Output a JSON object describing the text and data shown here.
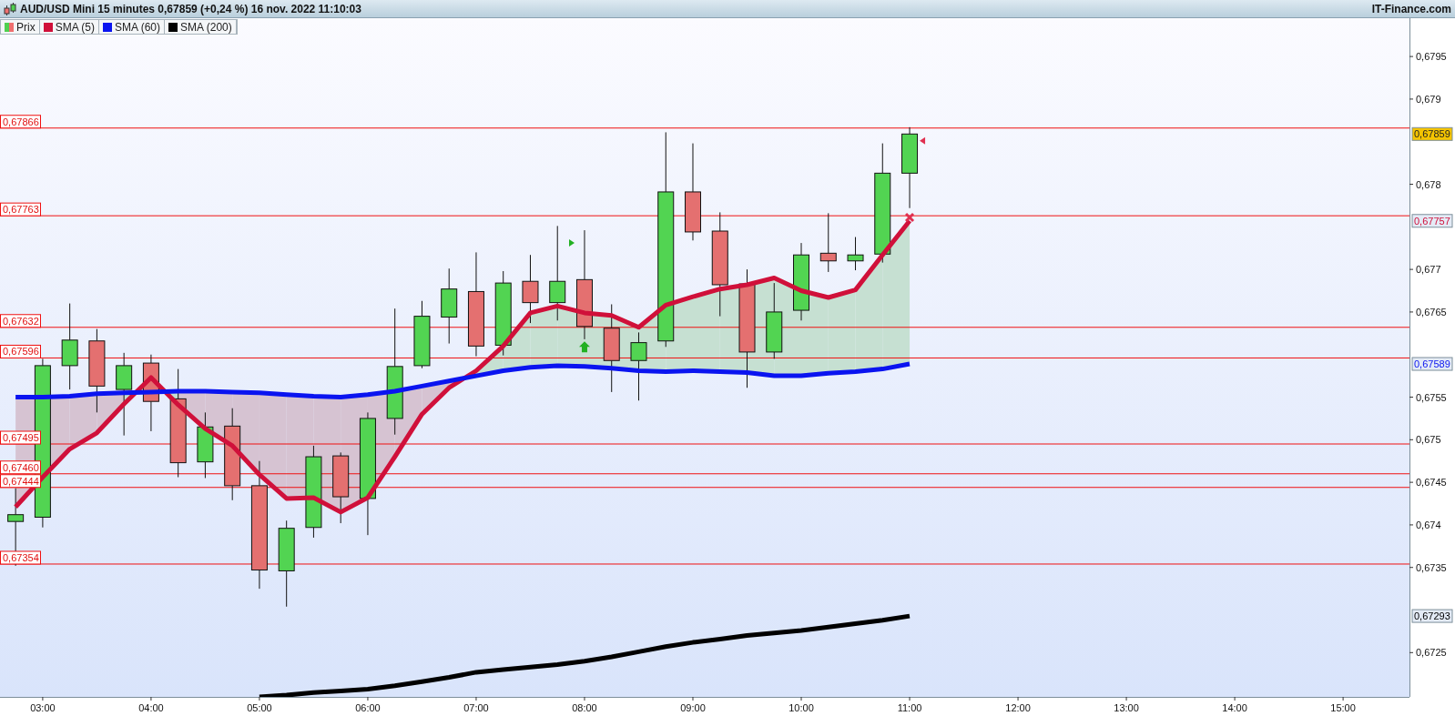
{
  "title_bar": {
    "title": "AUD/USD Mini 15 minutes 0,67859 (+0,24 %) 16 nov. 2022 11:10:03",
    "brand": "IT-Finance.com"
  },
  "chart_data": {
    "type": "line",
    "x": [
      2.75,
      3,
      3.25,
      3.5,
      3.75,
      4,
      4.25,
      4.5,
      4.75,
      5,
      5.25,
      5.5,
      5.75,
      6,
      6.25,
      6.5,
      6.75,
      7,
      7.25,
      7.5,
      7.75,
      8,
      8.25,
      8.5,
      8.75,
      9,
      9.25,
      9.5,
      9.75,
      10,
      10.25,
      10.5,
      10.75,
      11
    ],
    "xlim": [
      2.606,
      15.6125
    ],
    "ylim": [
      0.67198,
      0.67995
    ],
    "xticks": [
      {
        "value": 3,
        "label": "03:00"
      },
      {
        "value": 4,
        "label": "04:00"
      },
      {
        "value": 5,
        "label": "05:00"
      },
      {
        "value": 6,
        "label": "06:00"
      },
      {
        "value": 7,
        "label": "07:00"
      },
      {
        "value": 8,
        "label": "08:00"
      },
      {
        "value": 9,
        "label": "09:00"
      },
      {
        "value": 10,
        "label": "10:00"
      },
      {
        "value": 11,
        "label": "11:00"
      },
      {
        "value": 12,
        "label": "12:00"
      },
      {
        "value": 13,
        "label": "13:00"
      },
      {
        "value": 14,
        "label": "14:00"
      },
      {
        "value": 15,
        "label": "15:00"
      }
    ],
    "yticks": [
      {
        "value": 0.6795,
        "label": "0,6795"
      },
      {
        "value": 0.679,
        "label": "0,679"
      },
      {
        "value": 0.678,
        "label": "0,678"
      },
      {
        "value": 0.677,
        "label": "0,677"
      },
      {
        "value": 0.6765,
        "label": "0,6765"
      },
      {
        "value": 0.6755,
        "label": "0,6755"
      },
      {
        "value": 0.675,
        "label": "0,675"
      },
      {
        "value": 0.6745,
        "label": "0,6745"
      },
      {
        "value": 0.674,
        "label": "0,674"
      },
      {
        "value": 0.6735,
        "label": "0,6735"
      },
      {
        "value": 0.6725,
        "label": "0,6725"
      }
    ],
    "series": [
      {
        "name": "Prix",
        "type": "candlestick",
        "ohlc": [
          [
            0.67404,
            0.67443,
            0.67352,
            0.67412
          ],
          [
            0.67409,
            0.67595,
            0.67397,
            0.67587
          ],
          [
            0.67587,
            0.6766,
            0.67559,
            0.67617
          ],
          [
            0.67616,
            0.6763,
            0.67532,
            0.67563
          ],
          [
            0.67559,
            0.67602,
            0.67505,
            0.67587
          ],
          [
            0.6759,
            0.676,
            0.6751,
            0.67545
          ],
          [
            0.67548,
            0.67583,
            0.67456,
            0.67473
          ],
          [
            0.67474,
            0.67532,
            0.67455,
            0.67515
          ],
          [
            0.67516,
            0.67537,
            0.67429,
            0.67446
          ],
          [
            0.67446,
            0.67475,
            0.67325,
            0.67347
          ],
          [
            0.67346,
            0.67405,
            0.67304,
            0.67396
          ],
          [
            0.67397,
            0.67493,
            0.67385,
            0.6748
          ],
          [
            0.67481,
            0.67485,
            0.67402,
            0.67433
          ],
          [
            0.67431,
            0.67532,
            0.67388,
            0.67525
          ],
          [
            0.67525,
            0.67654,
            0.67506,
            0.67586
          ],
          [
            0.67587,
            0.67663,
            0.67584,
            0.67645
          ],
          [
            0.67644,
            0.67701,
            0.67613,
            0.67677
          ],
          [
            0.67674,
            0.6772,
            0.67598,
            0.6761
          ],
          [
            0.67611,
            0.67698,
            0.67599,
            0.67684
          ],
          [
            0.67686,
            0.67717,
            0.67637,
            0.67661
          ],
          [
            0.67661,
            0.67751,
            0.6764,
            0.67686
          ],
          [
            0.67688,
            0.67746,
            0.67618,
            0.67633
          ],
          [
            0.67631,
            0.67659,
            0.67556,
            0.67593
          ],
          [
            0.67593,
            0.67626,
            0.67546,
            0.67614
          ],
          [
            0.67616,
            0.67861,
            0.67609,
            0.67791
          ],
          [
            0.67791,
            0.67848,
            0.67734,
            0.67744
          ],
          [
            0.67745,
            0.67767,
            0.67645,
            0.67682
          ],
          [
            0.67683,
            0.677,
            0.67561,
            0.67603
          ],
          [
            0.67603,
            0.67684,
            0.67595,
            0.6765
          ],
          [
            0.67652,
            0.67731,
            0.6764,
            0.67717
          ],
          [
            0.67719,
            0.67766,
            0.67697,
            0.6771
          ],
          [
            0.6771,
            0.67738,
            0.67699,
            0.67717
          ],
          [
            0.67718,
            0.67848,
            0.67708,
            0.67813
          ],
          [
            0.67813,
            0.67867,
            0.67772,
            0.67859
          ]
        ]
      },
      {
        "name": "SMA (5)",
        "color": "#d0103a",
        "values": [
          0.67421,
          0.67456,
          0.67489,
          0.67508,
          0.67542,
          0.67573,
          0.67541,
          0.67513,
          0.67493,
          0.67459,
          0.67431,
          0.67432,
          0.67415,
          0.67432,
          0.6748,
          0.6753,
          0.67561,
          0.67581,
          0.6761,
          0.67649,
          0.67657,
          0.67649,
          0.67646,
          0.67632,
          0.67658,
          0.67668,
          0.67677,
          0.67682,
          0.6769,
          0.67675,
          0.67667,
          0.67676,
          0.67717,
          0.67757
        ]
      },
      {
        "name": "SMA (60)",
        "color": "#0a14f0",
        "values": [
          0.6755,
          0.6755,
          0.67551,
          0.67554,
          0.67555,
          0.67556,
          0.67557,
          0.67557,
          0.67556,
          0.67555,
          0.67553,
          0.67551,
          0.6755,
          0.67553,
          0.67557,
          0.67563,
          0.67569,
          0.67575,
          0.67581,
          0.67585,
          0.67587,
          0.67586,
          0.67584,
          0.67581,
          0.6758,
          0.67581,
          0.6758,
          0.67579,
          0.67575,
          0.67575,
          0.67578,
          0.6758,
          0.67583,
          0.67589
        ]
      },
      {
        "name": "SMA (200)",
        "color": "#000000",
        "values": [
          null,
          null,
          null,
          null,
          null,
          null,
          null,
          null,
          null,
          0.67198,
          0.672,
          0.67203,
          0.67205,
          0.67207,
          0.67211,
          0.67216,
          0.67221,
          0.67227,
          0.6723,
          0.67233,
          0.67236,
          0.6724,
          0.67245,
          0.67251,
          0.67257,
          0.67262,
          0.67266,
          0.6727,
          0.67273,
          0.67276,
          0.6728,
          0.67284,
          0.67288,
          0.67293
        ]
      }
    ],
    "ref_lines": [
      {
        "axis": "y",
        "value": 0.67866,
        "label": "0,67866"
      },
      {
        "axis": "y",
        "value": 0.67763,
        "label": "0,67763"
      },
      {
        "axis": "y",
        "value": 0.67632,
        "label": "0,67632"
      },
      {
        "axis": "y",
        "value": 0.67596,
        "label": "0,67596"
      },
      {
        "axis": "y",
        "value": 0.67495,
        "label": "0,67495"
      },
      {
        "axis": "y",
        "value": 0.6746,
        "label": "0,67460"
      },
      {
        "axis": "y",
        "value": 0.67444,
        "label": "0,67444"
      },
      {
        "axis": "y",
        "value": 0.67354,
        "label": "0,67354"
      }
    ]
  },
  "price_badges": [
    {
      "label": "0,67859"
    },
    {
      "label": "0,67757"
    },
    {
      "label": "0,67589"
    },
    {
      "label": "0,67293"
    }
  ]
}
